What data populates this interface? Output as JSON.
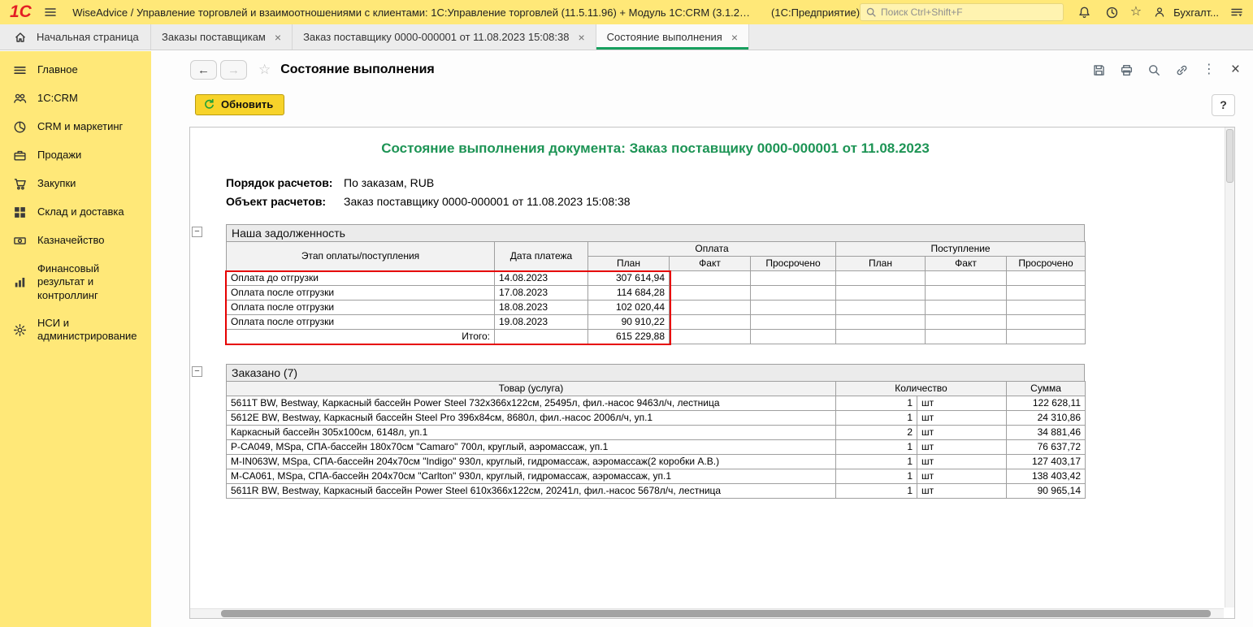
{
  "colors": {
    "brand_yellow": "#ffe878",
    "accent_green": "#17a05e",
    "title_green": "#1d9455",
    "highlight_red": "#e60000",
    "button_yellow": "#f7d32a"
  },
  "icons": {
    "back": "←",
    "forward": "→",
    "star": "☆",
    "kebab": "⋮",
    "close": "×",
    "minus": "−"
  },
  "topbar": {
    "logo": "1С",
    "window_title": "WiseAdvice / Управление торговлей и взаимоотношениями с клиентами: 1С:Управление торговлей (11.5.11.96) + Модуль 1С:CRM (3.1.2…",
    "app_suffix": "(1С:Предприятие)",
    "search_placeholder": "Поиск Ctrl+Shift+F",
    "user": "Бухгалт..."
  },
  "tabs": [
    {
      "label": "Начальная страница"
    },
    {
      "label": "Заказы поставщикам"
    },
    {
      "label": "Заказ поставщику 0000-000001 от 11.08.2023 15:08:38"
    },
    {
      "label": "Состояние выполнения"
    }
  ],
  "sidebar": {
    "items": [
      "Главное",
      "1С:CRM",
      "CRM и маркетинг",
      "Продажи",
      "Закупки",
      "Склад и доставка",
      "Казначейство",
      "Финансовый результат и контроллинг",
      "НСИ и администрирование"
    ]
  },
  "window": {
    "title": "Состояние выполнения",
    "refresh_label": "Обновить",
    "help_label": "?"
  },
  "report": {
    "title": "Состояние выполнения документа: Заказ поставщику 0000-000001 от 11.08.2023",
    "fields": [
      {
        "label": "Порядок расчетов:",
        "value": "По заказам, RUB"
      },
      {
        "label": "Объект расчетов:",
        "value": "Заказ поставщику 0000-000001 от 11.08.2023 15:08:38"
      }
    ],
    "debt": {
      "title": "Наша задолженность",
      "headers": {
        "stage": "Этап оплаты/поступления",
        "date": "Дата платежа",
        "payment": "Оплата",
        "receipt": "Поступление",
        "subs": [
          "План",
          "Факт",
          "Просрочено"
        ]
      },
      "rows": [
        {
          "stage": "Оплата до отгрузки",
          "date": "14.08.2023",
          "plan": "307 614,94"
        },
        {
          "stage": "Оплата после отгрузки",
          "date": "17.08.2023",
          "plan": "114 684,28"
        },
        {
          "stage": "Оплата после отгрузки",
          "date": "18.08.2023",
          "plan": "102 020,44"
        },
        {
          "stage": "Оплата после отгрузки",
          "date": "19.08.2023",
          "plan": "90 910,22"
        }
      ],
      "total": {
        "label": "Итого:",
        "plan": "615 229,88"
      }
    },
    "ordered": {
      "title": "Заказано (7)",
      "headers": {
        "product": "Товар (услуга)",
        "qty": "Количество",
        "sum": "Сумма"
      },
      "rows": [
        {
          "product": "5611T BW, Bestway, Каркасный бассейн Power Steel 732х366х122см, 25495л, фил.-насос 9463л/ч, лестница",
          "qty": "1",
          "unit": "шт",
          "sum": "122 628,11"
        },
        {
          "product": "5612E BW, Bestway, Каркасный бассейн Steel Pro 396х84см, 8680л, фил.-насос 2006л/ч, уп.1",
          "qty": "1",
          "unit": "шт",
          "sum": "24 310,86"
        },
        {
          "product": "Каркасный бассейн 305х100см, 6148л, уп.1",
          "qty": "2",
          "unit": "шт",
          "sum": "34 881,46"
        },
        {
          "product": "P-CA049, MSpa, СПА-бассейн 180х70см \"Camaro\" 700л, круглый, аэромассаж, уп.1",
          "qty": "1",
          "unit": "шт",
          "sum": "76 637,72"
        },
        {
          "product": "M-IN063W, MSpa, СПА-бассейн 204х70см \"Indigo\" 930л, круглый, гидромассаж, аэромассаж(2 коробки А.В.)",
          "qty": "1",
          "unit": "шт",
          "sum": "127 403,17"
        },
        {
          "product": "M-CA061, MSpa, СПА-бассейн 204х70см \"Carlton\" 930л, круглый, гидромассаж, аэромассаж, уп.1",
          "qty": "1",
          "unit": "шт",
          "sum": "138 403,42"
        },
        {
          "product": "5611R BW, Bestway, Каркасный бассейн Power Steel 610х366х122см, 20241л, фил.-насос 5678л/ч, лестница",
          "qty": "1",
          "unit": "шт",
          "sum": "90 965,14"
        }
      ]
    }
  }
}
